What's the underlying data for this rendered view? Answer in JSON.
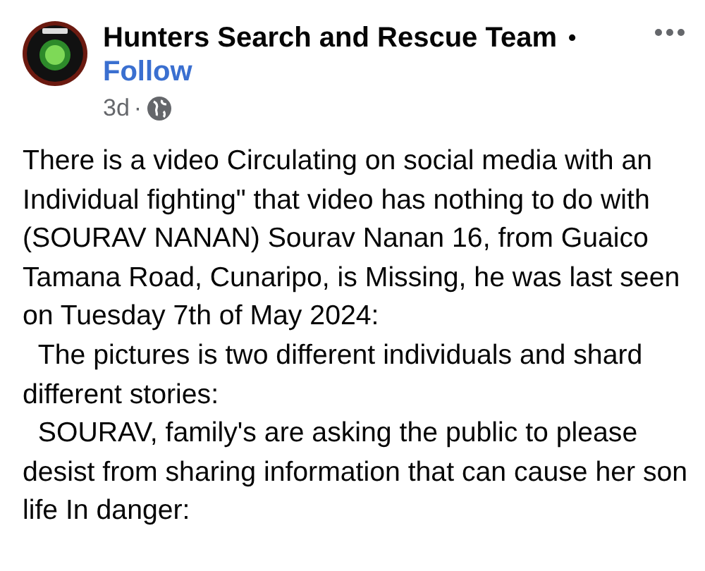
{
  "post": {
    "author": "Hunters Search and Rescue Team",
    "separator": "•",
    "follow": "Follow",
    "time": "3d",
    "time_separator": "·",
    "paragraphs": [
      "There is a video Circulating on social media with an Individual fighting\" that video has nothing to do with (SOURAV NANAN) Sourav Nanan 16, from Guaico Tamana Road, Cunaripo, is Missing, he was last seen on Tuesday 7th of May 2024:",
      "  The pictures is two different individuals and shard different stories:",
      "  SOURAV, family's are asking the public to please desist from sharing information that can cause her son life In danger:"
    ]
  }
}
